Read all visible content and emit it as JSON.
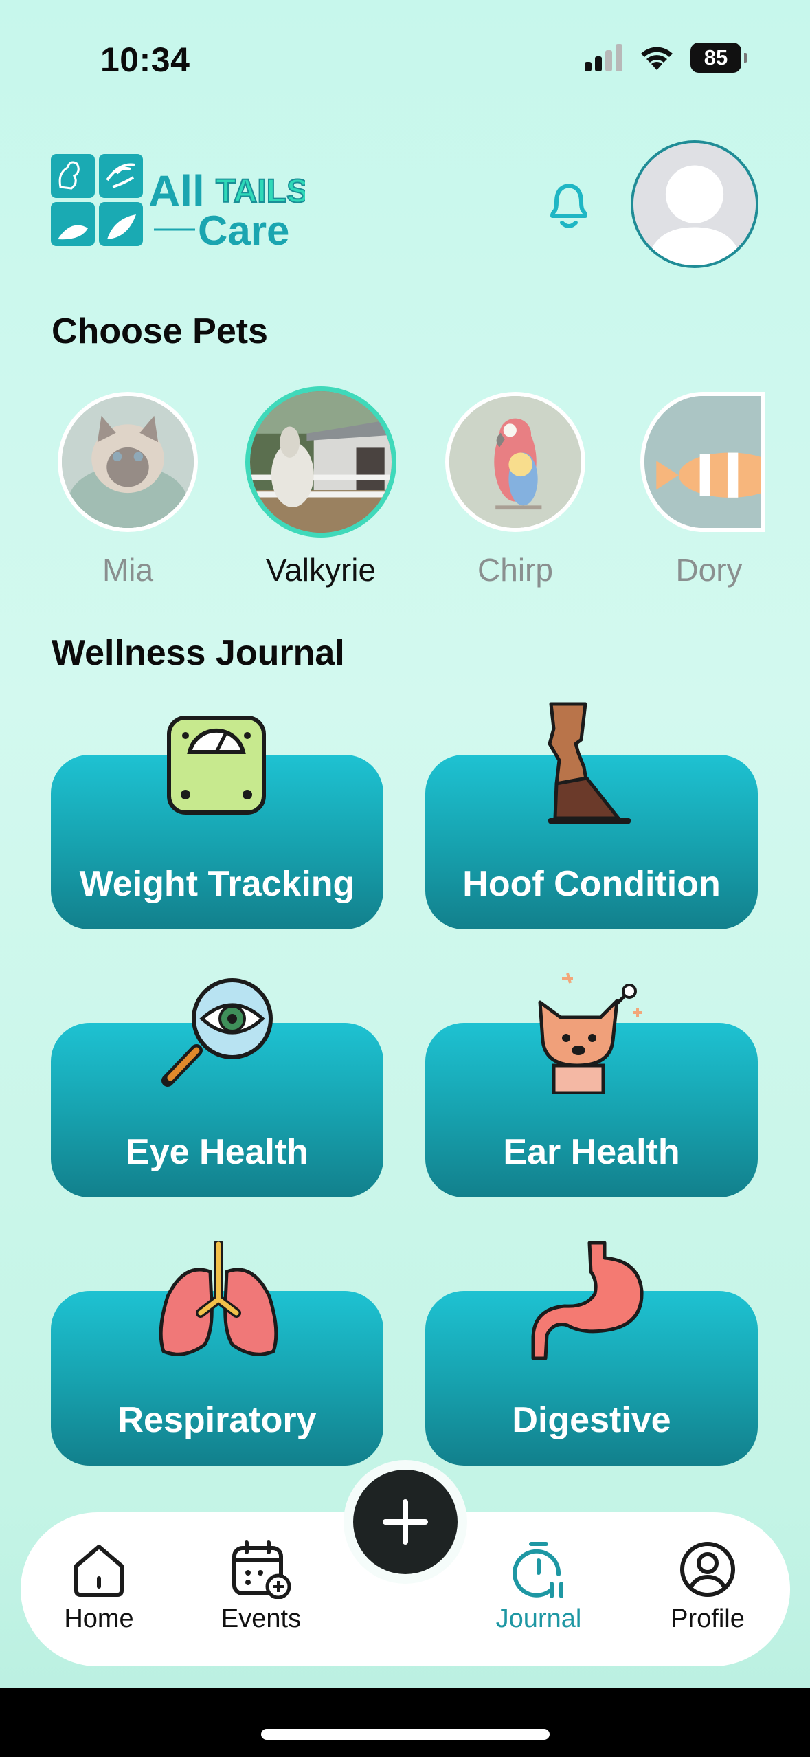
{
  "status_bar": {
    "time": "10:34",
    "battery": "85"
  },
  "brand": {
    "line1_a": "All",
    "line1_b": "TAILS",
    "line2": "Care"
  },
  "sections": {
    "choose_pets": "Choose Pets",
    "wellness_journal": "Wellness Journal"
  },
  "pets": [
    {
      "name": "Mia",
      "selected": false
    },
    {
      "name": "Valkyrie",
      "selected": true
    },
    {
      "name": "Chirp",
      "selected": false
    },
    {
      "name": "Dory",
      "selected": false
    }
  ],
  "journal_cards": [
    {
      "label": "Weight Tracking",
      "icon": "scale-icon"
    },
    {
      "label": "Hoof Condition",
      "icon": "hoof-icon"
    },
    {
      "label": "Eye Health",
      "icon": "magnifier-eye-icon"
    },
    {
      "label": "Ear Health",
      "icon": "dog-ear-icon"
    },
    {
      "label": "Respiratory",
      "icon": "lungs-icon"
    },
    {
      "label": "Digestive",
      "icon": "stomach-icon"
    }
  ],
  "tabs": [
    {
      "label": "Home",
      "icon": "home-icon",
      "active": false
    },
    {
      "label": "Events",
      "icon": "calendar-add-icon",
      "active": false
    },
    {
      "label": "Journal",
      "icon": "timer-icon",
      "active": true
    },
    {
      "label": "Profile",
      "icon": "profile-icon",
      "active": false
    }
  ],
  "colors": {
    "accent": "#1e97a3",
    "card_top": "#1ec2d2",
    "card_bottom": "#12808c",
    "selected_ring": "#3fd9ba",
    "background": "#c7f7ec"
  }
}
